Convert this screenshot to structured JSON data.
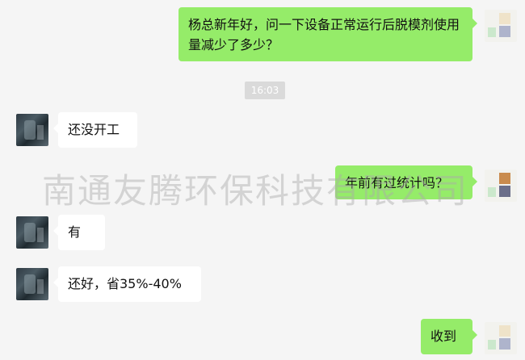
{
  "messages": [
    {
      "id": "m1",
      "direction": "outgoing",
      "text": "杨总新年好，问一下设备正常运行后脱模剂使用量减少了多少？"
    },
    {
      "id": "m2",
      "direction": "incoming",
      "text": "还没开工"
    },
    {
      "id": "m3",
      "direction": "outgoing",
      "text": "年前有过统计吗？"
    },
    {
      "id": "m4",
      "direction": "incoming",
      "text": "有"
    },
    {
      "id": "m5",
      "direction": "incoming",
      "text": "还好，省35%-40%"
    },
    {
      "id": "m6",
      "direction": "outgoing",
      "text": "收到"
    }
  ],
  "timestamp": "16:03",
  "watermark": "南通友腾环保科技有限公司",
  "colors": {
    "background": "#f5f5f5",
    "outgoing_bubble": "#95ec69",
    "incoming_bubble": "#ffffff",
    "time_badge": "#dadada"
  }
}
